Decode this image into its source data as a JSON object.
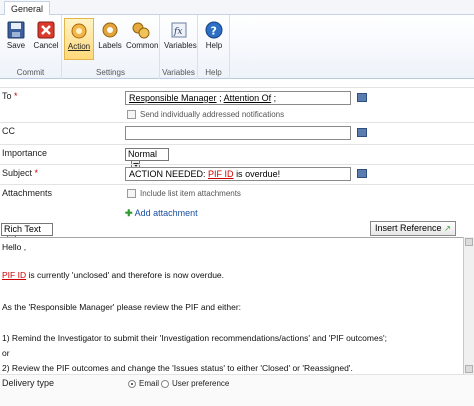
{
  "ribbon": {
    "tab_label": "General",
    "buttons": [
      {
        "label": "Save",
        "icon": "save-icon"
      },
      {
        "label": "Cancel",
        "icon": "cancel-icon"
      },
      {
        "label": "Action",
        "icon": "action-icon"
      },
      {
        "label": "Labels",
        "icon": "labels-icon"
      },
      {
        "label": "Common",
        "icon": "common-icon"
      },
      {
        "label": "Variables",
        "icon": "variables-icon"
      },
      {
        "label": "Help",
        "icon": "help-icon"
      }
    ],
    "groups": [
      "Commit",
      "Settings",
      "Variables",
      "Help"
    ]
  },
  "form": {
    "to": {
      "label": "To",
      "required_mark": "*",
      "value_a": "Responsible Manager",
      "value_sep": ";",
      "value_b": "Attention Of",
      "value_end": ";",
      "checkbox_label": "Send individually addressed notifications"
    },
    "cc": {
      "label": "CC",
      "value": ""
    },
    "importance": {
      "label": "Importance",
      "value": "Normal"
    },
    "subject": {
      "label": "Subject",
      "required_mark": "*",
      "prefix": "ACTION NEEDED:",
      "ref": "PIF ID",
      "suffix": "is overdue!"
    },
    "attachments": {
      "label": "Attachments",
      "checkbox_label": "Include list item attachments",
      "add_link": "Add attachment"
    },
    "editor": {
      "mode": "Rich Text",
      "insert_reference": "Insert Reference",
      "lines": {
        "greeting": "Hello ,",
        "line2_ref": "PIF ID",
        "line2_rest": "is currently 'unclosed' and therefore is now overdue.",
        "line3": "As the 'Responsible Manager' please review the PIF and either:",
        "line4": "1) Remind the Investigator to submit their 'Investigation recommendations/actions' and 'PIF outcomes';",
        "line5": "or",
        "line6": "2) Review the PIF outcomes and change the 'Issues status' to either 'Closed' or 'Reassigned'."
      }
    },
    "delivery": {
      "label": "Delivery type",
      "options": [
        "Email",
        "User preference"
      ],
      "selected": "Email"
    }
  },
  "colors": {
    "required": "#c00000",
    "link": "#1a4fa0",
    "active_button": "#ffd87a"
  }
}
